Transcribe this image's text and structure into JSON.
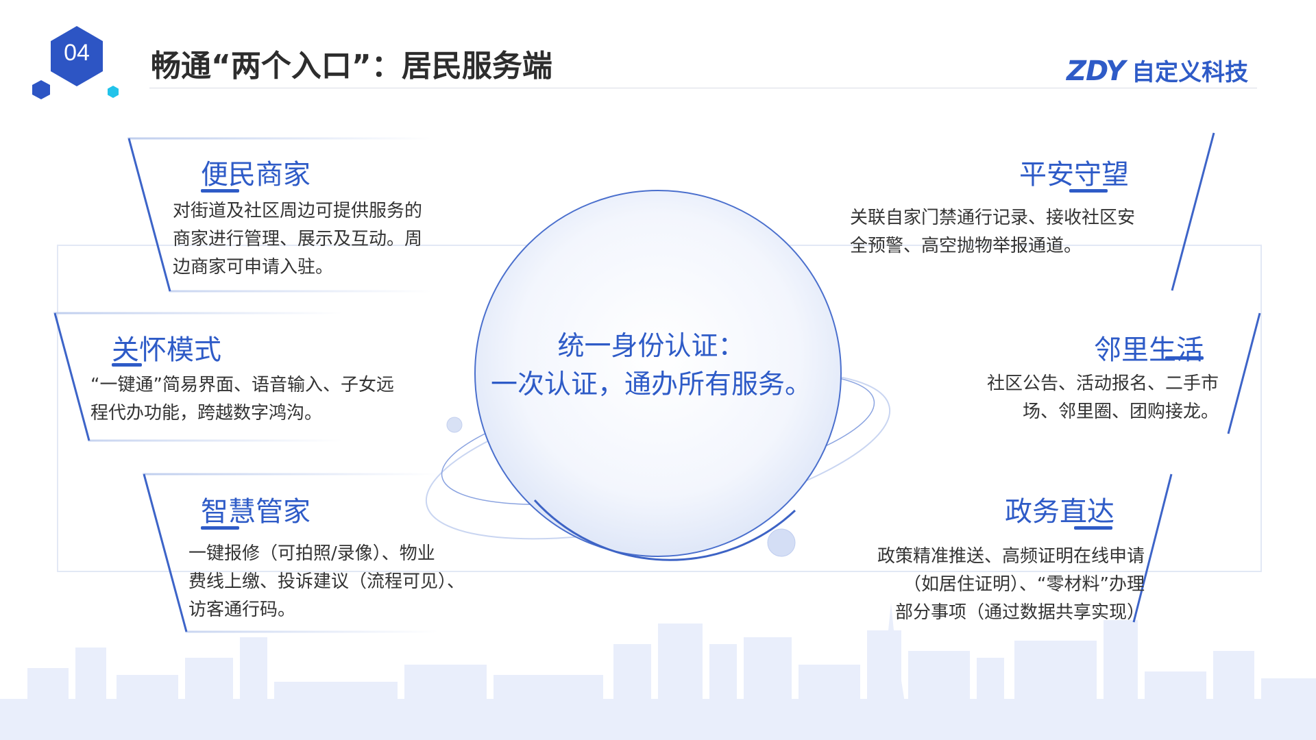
{
  "header": {
    "section_number": "04",
    "title": "畅通“两个入口”：居民服务端",
    "brand_en": "ZDY",
    "brand_cn": "自定义科技"
  },
  "center": {
    "line1": "统一身份认证：",
    "line2": "一次认证，通办所有服务。"
  },
  "cards": {
    "merchant": {
      "title": "便民商家",
      "lines": [
        "对街道及社区周边可提供服务的",
        "商家进行管理、展示及互动。周",
        "边商家可申请入驻。"
      ]
    },
    "care": {
      "title": "关怀模式",
      "lines": [
        "“一键通”简易界面、语音输入、子女远",
        "程代办功能，跨越数字鸿沟。"
      ]
    },
    "butler": {
      "title": "智慧管家",
      "lines": [
        "一键报修（可拍照/录像）、物业",
        "费线上缴、投诉建议（流程可见）、",
        "访客通行码。"
      ]
    },
    "safety": {
      "title": "平安守望",
      "lines": [
        "关联自家门禁通行记录、接收社区安",
        "全预警、高空抛物举报通道。"
      ]
    },
    "neighbor": {
      "title": "邻里生活",
      "lines": [
        "社区公告、活动报名、二手市",
        "场、邻里圈、团购接龙。"
      ]
    },
    "gov": {
      "title": "政务直达",
      "lines": [
        "政策精准推送、高频证明在线申请",
        "（如居住证明）、“零材料”办理",
        "部分事项（通过数据共享实现）"
      ]
    }
  },
  "colors": {
    "accent": "#2e5bc7",
    "badge": "#2d55c4",
    "cyan_dot": "#22c3ea",
    "skyline": "#e6ecfa"
  }
}
